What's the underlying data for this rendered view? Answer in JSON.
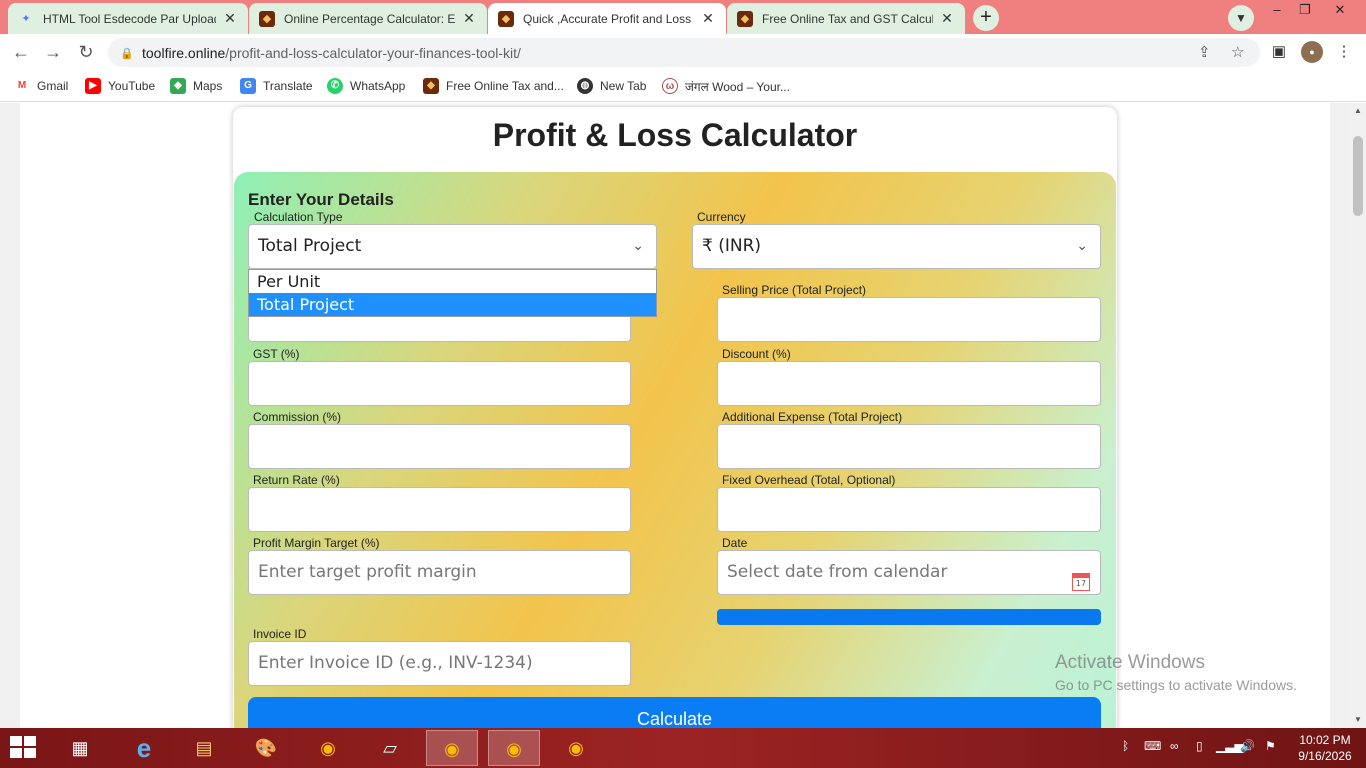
{
  "browser": {
    "tabs": [
      {
        "title": "HTML Tool Esdecode Par Upload",
        "icon": "sparkle-icon",
        "active": false
      },
      {
        "title": "Online Percentage Calculator: Eas",
        "icon": "toolfire-icon",
        "active": false
      },
      {
        "title": "Quick ,Accurate Profit and Loss C",
        "icon": "toolfire-icon",
        "active": true
      },
      {
        "title": "Free Online Tax and GST Calculat",
        "icon": "toolfire-icon",
        "active": false
      }
    ],
    "url_host": "toolfire.online",
    "url_path": "/profit-and-loss-calculator-your-finances-tool-kit/",
    "bookmarks": [
      {
        "label": "Gmail",
        "icon": "gmail-icon",
        "color": "#ea4335"
      },
      {
        "label": "YouTube",
        "icon": "youtube-icon",
        "color": "#ff0000"
      },
      {
        "label": "Maps",
        "icon": "maps-icon",
        "color": "#34a853"
      },
      {
        "label": "Translate",
        "icon": "translate-icon",
        "color": "#4285f4"
      },
      {
        "label": "WhatsApp",
        "icon": "whatsapp-icon",
        "color": "#25d366"
      },
      {
        "label": "Free Online Tax and...",
        "icon": "toolfire-icon",
        "color": "#7a3b12"
      },
      {
        "label": "New Tab",
        "icon": "globe-icon",
        "color": "#333333"
      },
      {
        "label": "जंगल Wood – Your...",
        "icon": "wood-icon",
        "color": "#a05050"
      }
    ]
  },
  "page": {
    "title": "Profit & Loss Calculator",
    "section_heading": "Enter Your Details",
    "fields": {
      "calculation_type": {
        "label": "Calculation Type",
        "value": "Total Project"
      },
      "currency": {
        "label": "Currency",
        "value": "₹ (INR)"
      },
      "selling_price": {
        "label": "Selling Price (Total Project)"
      },
      "gst": {
        "label": "GST (%)"
      },
      "discount": {
        "label": "Discount (%)"
      },
      "commission": {
        "label": "Commission (%)"
      },
      "additional_expense": {
        "label": "Additional Expense (Total Project)"
      },
      "return_rate": {
        "label": "Return Rate (%)"
      },
      "fixed_overhead": {
        "label": "Fixed Overhead (Total, Optional)"
      },
      "profit_margin": {
        "label": "Profit Margin Target (%)",
        "placeholder": "Enter target profit margin"
      },
      "date": {
        "label": "Date",
        "placeholder": "Select date from calendar"
      },
      "invoice_id": {
        "label": "Invoice ID",
        "placeholder": "Enter Invoice ID (e.g., INV-1234)"
      }
    },
    "dropdown_options": [
      "Per Unit",
      "Total Project"
    ],
    "dropdown_selected": "Total Project",
    "calculate_label": "Calculate"
  },
  "watermark": {
    "line1": "Activate Windows",
    "line2": "Go to PC settings to activate Windows."
  },
  "taskbar": {
    "time": "10:02 PM",
    "date": "9/16/2026"
  },
  "colors": {
    "tab_strip": "#f08080",
    "accent_blue": "#0a7df5",
    "taskbar": "#8b1c1c"
  }
}
